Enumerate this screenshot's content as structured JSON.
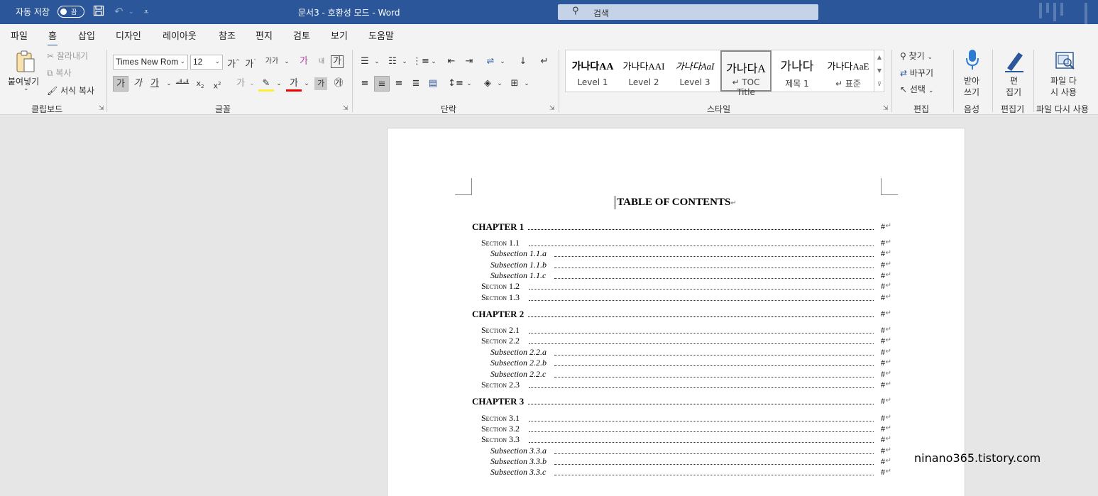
{
  "titlebar": {
    "autosave_label": "자동 저장",
    "autosave_state": "끔",
    "doc_title": "문서3  -  호환성 모드  -  Word",
    "search_placeholder": "검색"
  },
  "menu": {
    "tabs": [
      "파일",
      "홈",
      "삽입",
      "디자인",
      "레이아웃",
      "참조",
      "편지",
      "검토",
      "보기",
      "도움말"
    ],
    "active": "홈"
  },
  "ribbon": {
    "clipboard": {
      "paste": "붙여넣기",
      "cut": "잘라내기",
      "copy": "복사",
      "format_painter": "서식 복사",
      "label": "클립보드"
    },
    "font": {
      "font_name": "Times New Rom",
      "font_size": "12",
      "label": "글꼴"
    },
    "paragraph": {
      "label": "단락"
    },
    "styles": {
      "label": "스타일",
      "items": [
        {
          "sample": "가나다AA",
          "name": "Level 1"
        },
        {
          "sample": "가나다AAI",
          "name": "Level 2"
        },
        {
          "sample": "가나다AaI",
          "name": "Level 3"
        },
        {
          "sample": "가나다A",
          "name": "↵ TOC Title"
        },
        {
          "sample": "가나다",
          "name": "제목 1"
        },
        {
          "sample": "가나다AaE",
          "name": "↵ 표준"
        }
      ]
    },
    "editing": {
      "find": "찾기",
      "replace": "바꾸기",
      "select": "선택",
      "label": "편집"
    },
    "voice": {
      "dictate_1": "받아",
      "dictate_2": "쓰기",
      "label": "음성"
    },
    "editor": {
      "editor_1": "편",
      "editor_2": "집기",
      "label": "편집기"
    },
    "reuse": {
      "reuse_1": "파일 다",
      "reuse_2": "시 사용",
      "label": "파일 다시 사용"
    }
  },
  "document": {
    "title": "TABLE OF CONTENTS",
    "page_marker": "#",
    "toc": [
      {
        "level": 1,
        "label": "CHAPTER 1"
      },
      {
        "level": 2,
        "label": "Section 1.1"
      },
      {
        "level": 3,
        "label": "Subsection 1.1.a"
      },
      {
        "level": 3,
        "label": "Subsection 1.1.b"
      },
      {
        "level": 3,
        "label": "Subsection 1.1.c"
      },
      {
        "level": 2,
        "label": "Section 1.2"
      },
      {
        "level": 2,
        "label": "Section 1.3"
      },
      {
        "level": 1,
        "label": "CHAPTER 2"
      },
      {
        "level": 2,
        "label": "Section 2.1"
      },
      {
        "level": 2,
        "label": "Section 2.2"
      },
      {
        "level": 3,
        "label": "Subsection 2.2.a"
      },
      {
        "level": 3,
        "label": "Subsection 2.2.b"
      },
      {
        "level": 3,
        "label": "Subsection 2.2.c"
      },
      {
        "level": 2,
        "label": "Section 2.3"
      },
      {
        "level": 1,
        "label": "CHAPTER 3"
      },
      {
        "level": 2,
        "label": "Section 3.1"
      },
      {
        "level": 2,
        "label": "Section 3.2"
      },
      {
        "level": 2,
        "label": "Section 3.3"
      },
      {
        "level": 3,
        "label": "Subsection 3.3.a"
      },
      {
        "level": 3,
        "label": "Subsection 3.3.b"
      },
      {
        "level": 3,
        "label": "Subsection 3.3.c"
      }
    ]
  },
  "watermark": "ninano365.tistory.com",
  "colors": {
    "titlebar": "#2b579a",
    "ribbon": "#f3f3f3",
    "canvas": "#e6e6e6"
  }
}
